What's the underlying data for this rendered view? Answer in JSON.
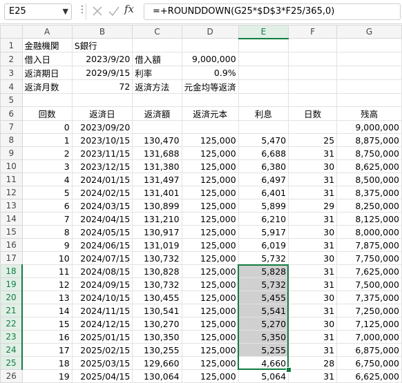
{
  "formula_bar": {
    "name_box": "E25",
    "formula": "=+ROUNDDOWN(G25*$D$3*F25/365,0)"
  },
  "columns": [
    "A",
    "B",
    "C",
    "D",
    "E",
    "F",
    "G"
  ],
  "active_column": "E",
  "rows": [
    {
      "n": "1",
      "cells": [
        "金融機関",
        "S銀行",
        "",
        "",
        "",
        "",
        ""
      ]
    },
    {
      "n": "2",
      "cells": [
        "借入日",
        "2023/9/20",
        "借入額",
        "9,000,000",
        "",
        "",
        ""
      ]
    },
    {
      "n": "3",
      "cells": [
        "返済期日",
        "2029/9/15",
        "利率",
        "0.9%",
        "",
        "",
        ""
      ]
    },
    {
      "n": "4",
      "cells": [
        "返済月数",
        "72",
        "返済方法",
        "元金均等返済",
        "",
        "",
        ""
      ]
    },
    {
      "n": "5",
      "cells": [
        "",
        "",
        "",
        "",
        "",
        "",
        ""
      ]
    },
    {
      "n": "6",
      "cells": [
        "回数",
        "返済日",
        "返済額",
        "返済元本",
        "利息",
        "日数",
        "残高"
      ]
    },
    {
      "n": "7",
      "cells": [
        "0",
        "2023/09/20",
        "",
        "",
        "",
        "",
        "9,000,000"
      ]
    },
    {
      "n": "8",
      "cells": [
        "1",
        "2023/10/15",
        "130,470",
        "125,000",
        "5,470",
        "25",
        "8,875,000"
      ]
    },
    {
      "n": "9",
      "cells": [
        "2",
        "2023/11/15",
        "131,688",
        "125,000",
        "6,688",
        "31",
        "8,750,000"
      ]
    },
    {
      "n": "10",
      "cells": [
        "3",
        "2023/12/15",
        "131,380",
        "125,000",
        "6,380",
        "30",
        "8,625,000"
      ]
    },
    {
      "n": "11",
      "cells": [
        "4",
        "2024/01/15",
        "131,497",
        "125,000",
        "6,497",
        "31",
        "8,500,000"
      ]
    },
    {
      "n": "12",
      "cells": [
        "5",
        "2024/02/15",
        "131,401",
        "125,000",
        "6,401",
        "31",
        "8,375,000"
      ]
    },
    {
      "n": "13",
      "cells": [
        "6",
        "2024/03/15",
        "130,899",
        "125,000",
        "5,899",
        "29",
        "8,250,000"
      ]
    },
    {
      "n": "14",
      "cells": [
        "7",
        "2024/04/15",
        "131,210",
        "125,000",
        "6,210",
        "31",
        "8,125,000"
      ]
    },
    {
      "n": "15",
      "cells": [
        "8",
        "2024/05/15",
        "130,917",
        "125,000",
        "5,917",
        "30",
        "8,000,000"
      ]
    },
    {
      "n": "16",
      "cells": [
        "9",
        "2024/06/15",
        "131,019",
        "125,000",
        "6,019",
        "31",
        "7,875,000"
      ]
    },
    {
      "n": "17",
      "cells": [
        "10",
        "2024/07/15",
        "130,732",
        "125,000",
        "5,732",
        "30",
        "7,750,000"
      ]
    },
    {
      "n": "18",
      "cells": [
        "11",
        "2024/08/15",
        "130,828",
        "125,000",
        "5,828",
        "31",
        "7,625,000"
      ]
    },
    {
      "n": "19",
      "cells": [
        "12",
        "2024/09/15",
        "130,732",
        "125,000",
        "5,732",
        "31",
        "7,500,000"
      ]
    },
    {
      "n": "20",
      "cells": [
        "13",
        "2024/10/15",
        "130,455",
        "125,000",
        "5,455",
        "30",
        "7,375,000"
      ]
    },
    {
      "n": "21",
      "cells": [
        "14",
        "2024/11/15",
        "130,541",
        "125,000",
        "5,541",
        "31",
        "7,250,000"
      ]
    },
    {
      "n": "22",
      "cells": [
        "15",
        "2024/12/15",
        "130,270",
        "125,000",
        "5,270",
        "30",
        "7,125,000"
      ]
    },
    {
      "n": "23",
      "cells": [
        "16",
        "2025/01/15",
        "130,350",
        "125,000",
        "5,350",
        "31",
        "7,000,000"
      ]
    },
    {
      "n": "24",
      "cells": [
        "17",
        "2025/02/15",
        "130,255",
        "125,000",
        "5,255",
        "31",
        "6,875,000"
      ]
    },
    {
      "n": "25",
      "cells": [
        "18",
        "2025/03/15",
        "129,660",
        "125,000",
        "4,660",
        "28",
        "6,750,000"
      ]
    },
    {
      "n": "26",
      "cells": [
        "19",
        "2025/04/15",
        "130,064",
        "125,000",
        "5,064",
        "31",
        "6,625,000"
      ]
    }
  ],
  "selection": {
    "range": "E18:E25",
    "active_cell": "E25",
    "color": "#107c41",
    "highlight": "#d0d0d0"
  }
}
